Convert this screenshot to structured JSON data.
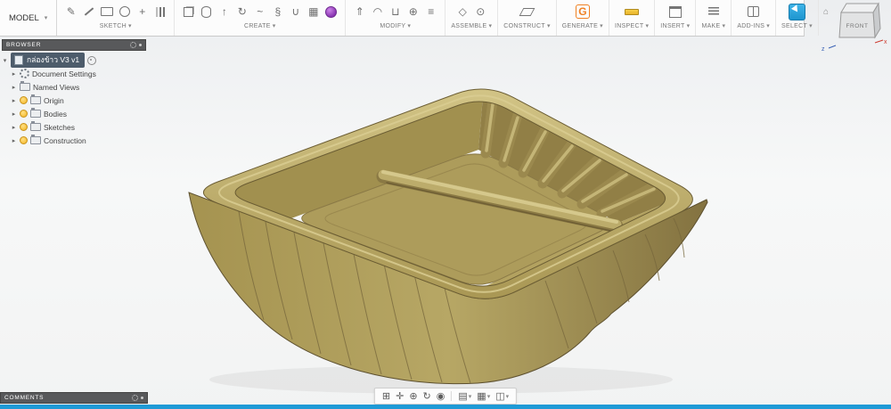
{
  "app": {
    "accent_blue": "#1e9ad6",
    "canvas_bg_top": "#eceef0",
    "canvas_bg_bottom": "#f2f3f3"
  },
  "toolbar": {
    "model_label": "MODEL",
    "caret": "▾",
    "groups": [
      {
        "label": "SKETCH",
        "icons": [
          {
            "name": "create-sketch-icon",
            "shape": "glyph",
            "glyph": "✎"
          },
          {
            "name": "line-icon",
            "shape": "line",
            "glyph": ""
          },
          {
            "name": "rectangle-icon",
            "shape": "rect",
            "glyph": ""
          },
          {
            "name": "circle-icon",
            "shape": "circle",
            "glyph": ""
          },
          {
            "name": "sketch-point-icon",
            "shape": "glyph",
            "glyph": "+"
          },
          {
            "name": "mirror-icon",
            "shape": "mirror",
            "glyph": ""
          }
        ]
      },
      {
        "label": "CREATE",
        "icons": [
          {
            "name": "box-primitive-icon",
            "shape": "box",
            "glyph": ""
          },
          {
            "name": "cylinder-primitive-icon",
            "shape": "cylinder",
            "glyph": ""
          },
          {
            "name": "extrude-icon",
            "shape": "glyph",
            "glyph": "↑"
          },
          {
            "name": "revolve-icon",
            "shape": "glyph",
            "glyph": "↻"
          },
          {
            "name": "sweep-icon",
            "shape": "glyph",
            "glyph": "~"
          },
          {
            "name": "coil-icon",
            "shape": "glyph",
            "glyph": "§"
          },
          {
            "name": "pipe-icon",
            "shape": "glyph",
            "glyph": "∪"
          },
          {
            "name": "pattern-icon",
            "shape": "glyph",
            "glyph": "▦"
          },
          {
            "name": "create-form-icon",
            "shape": "web",
            "glyph": ""
          }
        ]
      },
      {
        "label": "MODIFY",
        "icons": [
          {
            "name": "press-pull-icon",
            "shape": "glyph",
            "glyph": "⇑"
          },
          {
            "name": "fillet-icon",
            "shape": "glyph",
            "glyph": "◠"
          },
          {
            "name": "shell-icon",
            "shape": "glyph",
            "glyph": "⊔"
          },
          {
            "name": "combine-icon",
            "shape": "glyph",
            "glyph": "⊕"
          },
          {
            "name": "align-icon",
            "shape": "glyph",
            "glyph": "≡"
          }
        ]
      },
      {
        "label": "ASSEMBLE",
        "icons": [
          {
            "name": "new-component-icon",
            "shape": "glyph",
            "glyph": "◇"
          },
          {
            "name": "joint-icon",
            "shape": "glyph",
            "glyph": "⊙"
          }
        ]
      },
      {
        "label": "CONSTRUCT",
        "icons": [
          {
            "name": "construction-plane-icon",
            "shape": "plane",
            "glyph": ""
          }
        ]
      },
      {
        "label": "GENERATE",
        "icons": [
          {
            "name": "generate-icon",
            "shape": "g-badge",
            "glyph": "G"
          }
        ]
      },
      {
        "label": "INSPECT",
        "icons": [
          {
            "name": "measure-icon",
            "shape": "measure",
            "glyph": ""
          }
        ]
      },
      {
        "label": "INSERT",
        "icons": [
          {
            "name": "insert-icon",
            "shape": "insert",
            "glyph": ""
          }
        ]
      },
      {
        "label": "MAKE",
        "icons": [
          {
            "name": "3d-print-icon",
            "shape": "print",
            "glyph": ""
          }
        ]
      },
      {
        "label": "ADD-INS",
        "icons": [
          {
            "name": "addins-icon",
            "shape": "addins",
            "glyph": ""
          }
        ]
      },
      {
        "label": "SELECT",
        "icons": [
          {
            "name": "select-cursor-icon",
            "shape": "cursor",
            "glyph": ""
          }
        ]
      }
    ]
  },
  "browser": {
    "header": "BROWSER",
    "collapse_glyph": "▾",
    "expand_glyph": "▸",
    "root_label": "กล่องข้าว V3 v1",
    "items": [
      {
        "label": "Document Settings",
        "icon": "gear",
        "bulb": false
      },
      {
        "label": "Named Views",
        "icon": "folder",
        "bulb": false
      },
      {
        "label": "Origin",
        "icon": "folder",
        "bulb": true
      },
      {
        "label": "Bodies",
        "icon": "folder",
        "bulb": true
      },
      {
        "label": "Sketches",
        "icon": "folder",
        "bulb": true
      },
      {
        "label": "Construction",
        "icon": "folder",
        "bulb": true
      }
    ]
  },
  "comments": {
    "header": "COMMENTS"
  },
  "viewcube": {
    "front_label": "FRONT",
    "home_glyph": "⌂",
    "axis_x": "x",
    "axis_z": "z"
  },
  "navbar": {
    "caret": "▾",
    "separator_after": 4,
    "items": [
      {
        "name": "fit-icon",
        "glyph": "⊞",
        "dropdown": false
      },
      {
        "name": "pan-icon",
        "glyph": "✛",
        "dropdown": false
      },
      {
        "name": "zoom-icon",
        "glyph": "⊕",
        "dropdown": false
      },
      {
        "name": "orbit-icon",
        "glyph": "↻",
        "dropdown": false
      },
      {
        "name": "look-at-icon",
        "glyph": "◉",
        "dropdown": false
      },
      {
        "name": "display-settings-icon",
        "glyph": "▤",
        "dropdown": true
      },
      {
        "name": "grid-settings-icon",
        "glyph": "▦",
        "dropdown": true
      },
      {
        "name": "viewports-icon",
        "glyph": "◫",
        "dropdown": true
      }
    ]
  },
  "model": {
    "subject": "two-compartment-food-tray",
    "colors": {
      "body": "#ab9a58",
      "rim_light": "#cfc183",
      "wall_shadow": "#837240",
      "cavity": "#8d7b45",
      "outline": "#5e5130"
    }
  }
}
